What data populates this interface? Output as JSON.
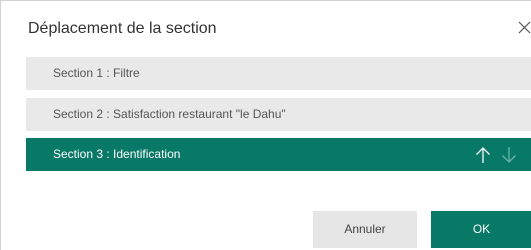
{
  "dialog": {
    "title": "Déplacement de la section",
    "close_icon": "close-icon"
  },
  "sections": [
    {
      "label": "Section 1 : Filtre",
      "selected": false
    },
    {
      "label": "Section 2 : Satisfaction restaurant \"le Dahu\"",
      "selected": false
    },
    {
      "label": "Section 3 : Identification",
      "selected": true
    }
  ],
  "move_controls": {
    "up_icon": "arrow-up-icon",
    "down_icon": "arrow-down-icon",
    "up_enabled": true,
    "down_enabled": false
  },
  "buttons": {
    "cancel_label": "Annuler",
    "ok_label": "OK"
  },
  "colors": {
    "accent": "#087966",
    "row_background": "#e9e9e9",
    "disabled_arrow": "#6fb3a7"
  }
}
